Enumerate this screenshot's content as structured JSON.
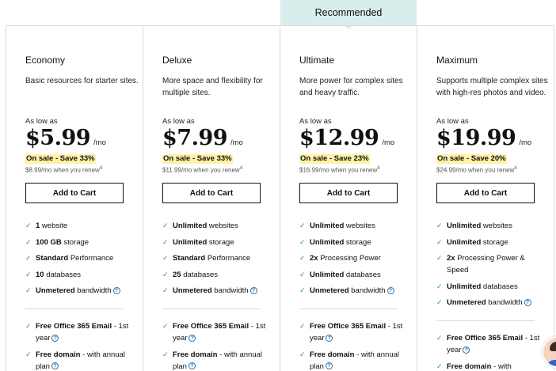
{
  "banner": {
    "label": "Recommended"
  },
  "plans": [
    {
      "name": "Economy",
      "description": "Basic resources for starter sites.",
      "as_low_as": "As low as",
      "price": "$5.99",
      "per": "/mo",
      "sale": "On sale - Save 33%",
      "renew": "$8.99/mo when you renew",
      "renew_note": "4",
      "cta": "Add to Cart",
      "features": [
        {
          "strong": "1",
          "rest": " website",
          "help": false
        },
        {
          "strong": "100 GB",
          "rest": " storage",
          "help": false
        },
        {
          "strong": "Standard",
          "rest": " Performance",
          "help": false
        },
        {
          "strong": "10",
          "rest": " databases",
          "help": false
        },
        {
          "strong": "Unmetered",
          "rest": " bandwidth",
          "help": true
        }
      ],
      "extras": [
        {
          "strong": "Free Office 365 Email",
          "rest": " - 1st year",
          "help": true
        },
        {
          "strong": "Free domain",
          "rest": " - with annual plan",
          "help": true
        }
      ]
    },
    {
      "name": "Deluxe",
      "description": "More space and flexibility for multiple sites.",
      "as_low_as": "As low as",
      "price": "$7.99",
      "per": "/mo",
      "sale": "On sale - Save 33%",
      "renew": "$11.99/mo when you renew",
      "renew_note": "4",
      "cta": "Add to Cart",
      "features": [
        {
          "strong": "Unlimited",
          "rest": " websites",
          "help": false
        },
        {
          "strong": "Unlimited",
          "rest": " storage",
          "help": false
        },
        {
          "strong": "Standard",
          "rest": " Performance",
          "help": false
        },
        {
          "strong": "25",
          "rest": " databases",
          "help": false
        },
        {
          "strong": "Unmetered",
          "rest": " bandwidth",
          "help": true
        }
      ],
      "extras": [
        {
          "strong": "Free Office 365 Email",
          "rest": " - 1st year",
          "help": true
        },
        {
          "strong": "Free domain",
          "rest": " - with annual plan",
          "help": true
        }
      ]
    },
    {
      "name": "Ultimate",
      "description": "More power for complex sites and heavy traffic.",
      "as_low_as": "As low as",
      "price": "$12.99",
      "per": "/mo",
      "sale": "On sale - Save 23%",
      "renew": "$16.99/mo when you renew",
      "renew_note": "4",
      "cta": "Add to Cart",
      "features": [
        {
          "strong": "Unlimited",
          "rest": " websites",
          "help": false
        },
        {
          "strong": "Unlimited",
          "rest": " storage",
          "help": false
        },
        {
          "strong": "2x",
          "rest": " Processing Power",
          "help": false
        },
        {
          "strong": "Unlimited",
          "rest": " databases",
          "help": false
        },
        {
          "strong": "Unmetered",
          "rest": " bandwidth",
          "help": true
        }
      ],
      "extras": [
        {
          "strong": "Free Office 365 Email",
          "rest": " - 1st year",
          "help": true
        },
        {
          "strong": "Free domain",
          "rest": " - with annual plan",
          "help": true
        }
      ]
    },
    {
      "name": "Maximum",
      "description": "Supports multiple complex sites with high-res photos and video.",
      "as_low_as": "As low as",
      "price": "$19.99",
      "per": "/mo",
      "sale": "On sale - Save 20%",
      "renew": "$24.99/mo when you renew",
      "renew_note": "4",
      "cta": "Add to Cart",
      "features": [
        {
          "strong": "Unlimited",
          "rest": " websites",
          "help": false
        },
        {
          "strong": "Unlimited",
          "rest": " storage",
          "help": false
        },
        {
          "strong": "2x",
          "rest": " Processing Power & Speed",
          "help": false
        },
        {
          "strong": "Unlimited",
          "rest": " databases",
          "help": false
        },
        {
          "strong": "Unmetered",
          "rest": " bandwidth",
          "help": true
        }
      ],
      "extras": [
        {
          "strong": "Free Office 365 Email",
          "rest": " - 1st year",
          "help": true
        },
        {
          "strong": "Free domain",
          "rest": " - with",
          "help": false
        }
      ]
    }
  ],
  "icons": {
    "check": "check-icon",
    "help": "help-circle-icon",
    "chat": "chat-avatar-icon"
  },
  "colors": {
    "banner_bg": "#d7eeec",
    "check": "#1b9a8f",
    "sale_highlight": "#fff1a8",
    "help": "#1b6fb5"
  }
}
